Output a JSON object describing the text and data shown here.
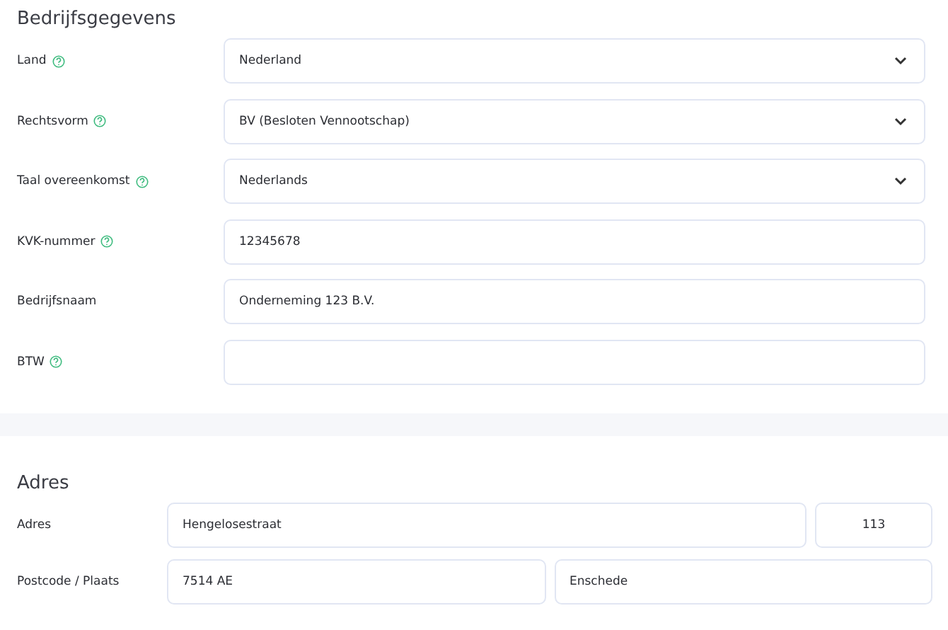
{
  "company_section": {
    "title": "Bedrijfsgegevens",
    "fields": [
      {
        "label": "Land",
        "help": true,
        "kind": "select",
        "value": "Nederland"
      },
      {
        "label": "Rechtsvorm",
        "help": true,
        "kind": "select",
        "value": "BV (Besloten Vennootschap)"
      },
      {
        "label": "Taal overeenkomst",
        "help": true,
        "kind": "select",
        "value": "Nederlands"
      },
      {
        "label": "KVK-nummer",
        "help": true,
        "kind": "input",
        "value": "12345678"
      },
      {
        "label": "Bedrijfsnaam",
        "help": false,
        "kind": "input",
        "value": "Onderneming 123 B.V."
      },
      {
        "label": "BTW",
        "help": true,
        "kind": "input"
      }
    ]
  },
  "address_section": {
    "title": "Adres",
    "rows": [
      {
        "label": "Adres",
        "first": {
          "value": "Hengelosestraat"
        },
        "second": {
          "value": "113"
        }
      },
      {
        "label": "Postcode / Plaats",
        "first": {
          "value": "7514 AE"
        },
        "second": {
          "value": "Enschede"
        }
      }
    ]
  }
}
